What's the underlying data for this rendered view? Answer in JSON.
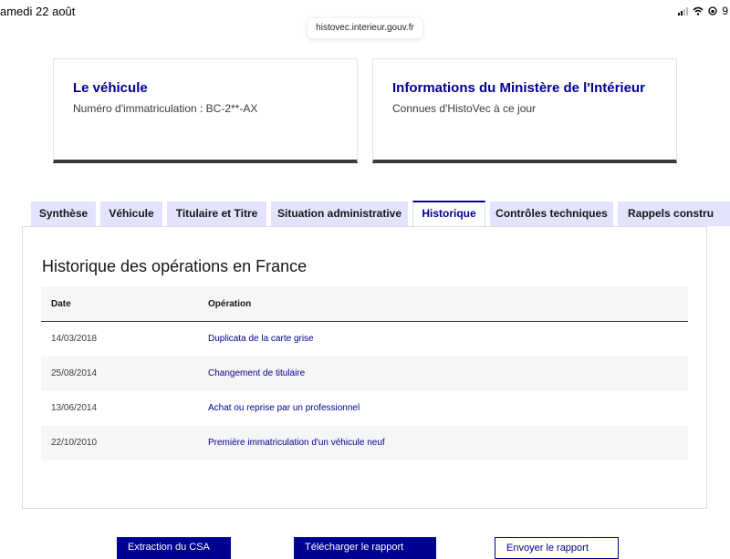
{
  "status_bar": {
    "date": "amedi 22 août",
    "battery": "9"
  },
  "browser": {
    "url": "histovec.interieur.gouv.fr"
  },
  "cards": [
    {
      "title": "Le véhicule",
      "subtitle": "Numéro d'immatriculation : BC-2**-AX"
    },
    {
      "title": "Informations du Ministère de l'Intérieur",
      "subtitle": "Connues d'HistoVec à ce jour"
    }
  ],
  "tabs": [
    {
      "label": "Synthèse",
      "active": false
    },
    {
      "label": "Véhicule",
      "active": false
    },
    {
      "label": "Titulaire et Titre",
      "active": false
    },
    {
      "label": "Situation administrative",
      "active": false
    },
    {
      "label": "Historique",
      "active": true
    },
    {
      "label": "Contrôles techniques",
      "active": false
    },
    {
      "label": "Rappels constru",
      "active": false
    }
  ],
  "panel": {
    "title": "Historique des opérations en France",
    "columns": {
      "date": "Date",
      "operation": "Opération"
    },
    "rows": [
      {
        "date": "14/03/2018",
        "operation": "Duplicata de la carte grise"
      },
      {
        "date": "25/08/2014",
        "operation": "Changement de titulaire"
      },
      {
        "date": "13/06/2014",
        "operation": "Achat ou reprise par un professionnel"
      },
      {
        "date": "22/10/2010",
        "operation": "Première immatriculation d'un véhicule neuf"
      }
    ]
  },
  "buttons": {
    "btn1": "Extraction du CSA",
    "btn2": "Télécharger le rapport",
    "btn3": "Envoyer le rapport"
  },
  "colors": {
    "primary": "#000091",
    "tab_bg": "#e3e3fd"
  }
}
